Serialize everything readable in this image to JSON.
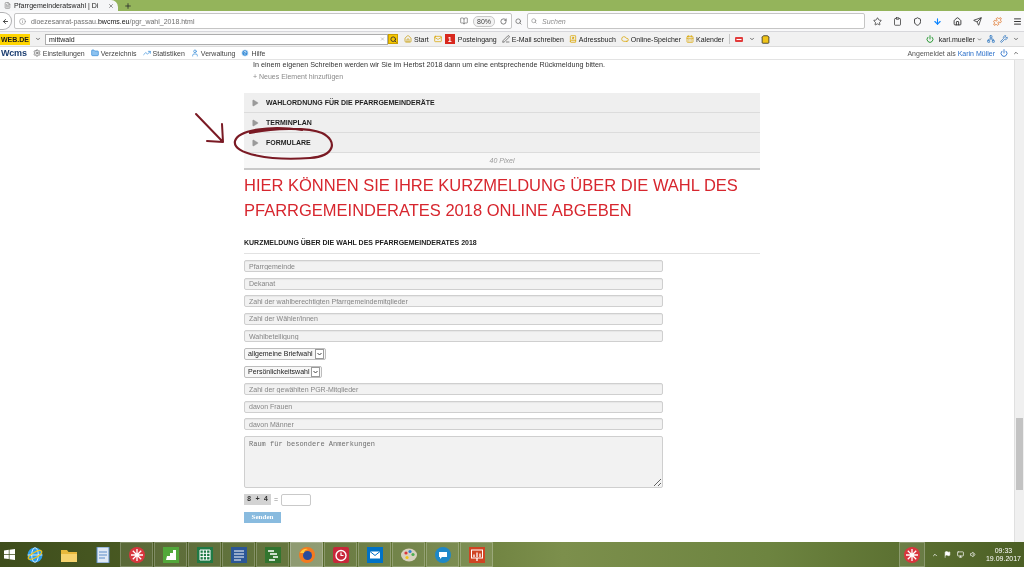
{
  "browser": {
    "tabs": [
      {
        "title": "Pfarrgemeinderatswahl | Di",
        "selected": true
      }
    ],
    "address": "dioezesanrat-passau.**bwcms.eu**/pgr_wahl_2018.html",
    "zoom": "80%",
    "search": {
      "placeholder": "Suchen"
    }
  },
  "webde_toolbar": {
    "logo": "WEB.DE",
    "search": {
      "value": "mittwald"
    },
    "items": [
      {
        "kind": "home",
        "label": "Start"
      },
      {
        "kind": "inbox",
        "label": "Posteingang",
        "badge": "1"
      },
      {
        "kind": "compose",
        "label": "E-Mail schreiben"
      },
      {
        "kind": "contacts",
        "label": "Adressbuch"
      },
      {
        "kind": "storage",
        "label": "Online-Speicher"
      },
      {
        "kind": "calendar",
        "label": "Kalender"
      }
    ],
    "account": "karl.mueller"
  },
  "cms_toolbar": {
    "logo": "Wcms",
    "items": [
      {
        "kind": "settings",
        "label": "Einstellungen"
      },
      {
        "kind": "directory",
        "label": "Verzeichnis"
      },
      {
        "kind": "statistics",
        "label": "Statistiken"
      },
      {
        "kind": "admin",
        "label": "Verwaltung"
      },
      {
        "kind": "help",
        "label": "Hilfe"
      }
    ],
    "login_text": "Angemeldet als",
    "login_user": "Karin Müller"
  },
  "page": {
    "intro": "In einem eigenen Schreiben werden wir Sie im Herbst 2018 dann um eine entsprechende Rückmeldung bitten.",
    "add_element": "+ Neues Element hinzufügen",
    "accordion": [
      {
        "title": "WAHLORDNUNG FÜR DIE PFARRGEMEINDERÄTE",
        "expanded": false
      },
      {
        "title": "TERMINPLAN",
        "expanded": false
      },
      {
        "title": "FORMULARE",
        "expanded": false
      }
    ],
    "spacer_label": "40 Pixel",
    "heading": "HIER KÖNNEN SIE IHRE KURZMELDUNG ÜBER DIE WAHL DES PFARRGEMEINDERATES 2018 ONLINE ABGEBEN",
    "form": {
      "title": "KURZMELDUNG ÜBER DIE WAHL DES PFARRGEMEINDERATES 2018",
      "fields": [
        {
          "kind": "input",
          "placeholder": "Pfarrgemeinde"
        },
        {
          "kind": "input",
          "placeholder": "Dekanat"
        },
        {
          "kind": "input",
          "placeholder": "Zahl der wahlberechtigten Pfarrgemeindemitglieder"
        },
        {
          "kind": "input",
          "placeholder": "Zahl der Wähler/innen"
        },
        {
          "kind": "input",
          "placeholder": "Wahlbeteiligung"
        },
        {
          "kind": "select",
          "value": "allgemeine Briefwahl"
        },
        {
          "kind": "select",
          "value": "Persönlichkeitswahl"
        },
        {
          "kind": "input",
          "placeholder": "Zahl der gewählten PGR-Mitglieder"
        },
        {
          "kind": "input",
          "placeholder": "davon Frauen"
        },
        {
          "kind": "input",
          "placeholder": "davon Männer"
        },
        {
          "kind": "textarea",
          "placeholder": "Raum für besondere Anmerkungen"
        }
      ],
      "captcha": {
        "question": "8 + 4",
        "equals": "="
      },
      "submit": "Senden"
    }
  },
  "taskbar": {
    "apps": [
      {
        "kind": "globe",
        "running": false,
        "selected": false
      },
      {
        "kind": "folder",
        "running": false,
        "selected": false
      },
      {
        "kind": "notes",
        "running": false,
        "selected": false
      },
      {
        "kind": "burst",
        "running": true,
        "selected": false
      },
      {
        "kind": "steps",
        "running": true,
        "selected": false
      },
      {
        "kind": "spreadsheet",
        "running": true,
        "selected": false
      },
      {
        "kind": "document",
        "running": true,
        "selected": false
      },
      {
        "kind": "project",
        "running": true,
        "selected": false
      },
      {
        "kind": "browser",
        "running": true,
        "selected": true
      },
      {
        "kind": "alarm",
        "running": true,
        "selected": false
      },
      {
        "kind": "mail",
        "running": true,
        "selected": false
      },
      {
        "kind": "palette",
        "running": true,
        "selected": false
      },
      {
        "kind": "chat",
        "running": true,
        "selected": false
      },
      {
        "kind": "slides",
        "running": true,
        "selected": false
      }
    ],
    "clock": {
      "time": "09:33",
      "date": "19.09.2017"
    }
  }
}
